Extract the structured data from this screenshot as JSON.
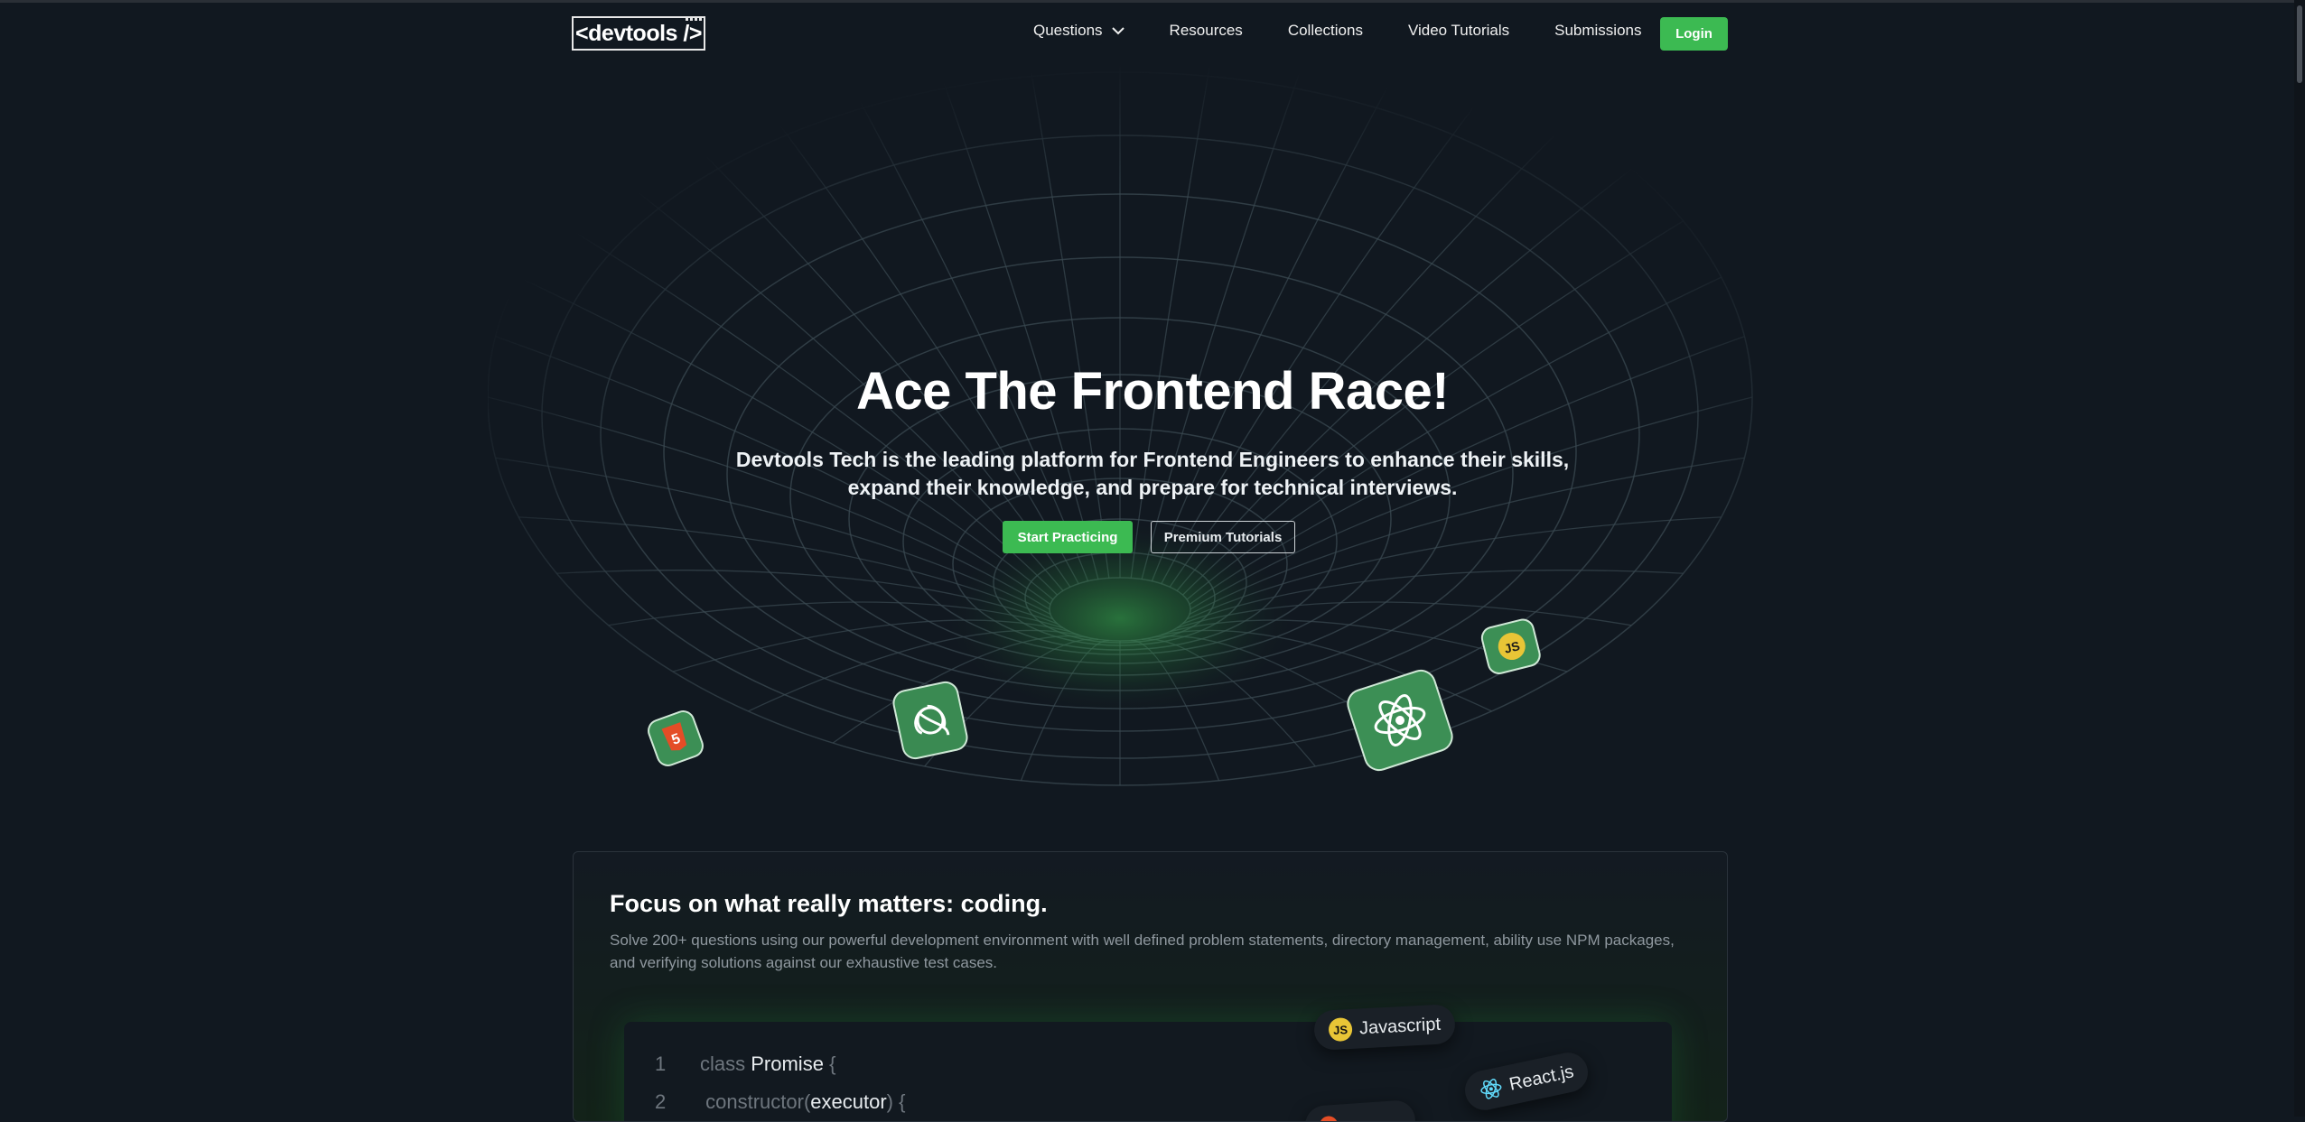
{
  "nav": {
    "logo_text": "<devtools />",
    "links": [
      "Questions",
      "Resources",
      "Collections",
      "Video Tutorials",
      "Submissions"
    ],
    "login_label": "Login"
  },
  "hero": {
    "title": "Ace The Frontend Race!",
    "subtitle": "Devtools Tech is the leading platform for Frontend Engineers to enhance their skills, expand their knowledge, and prepare for technical interviews.",
    "primary_cta": "Start Practicing",
    "secondary_cta": "Premium Tutorials",
    "tiles": [
      "html5-icon",
      "redux-icon",
      "react-icon",
      "javascript-icon"
    ]
  },
  "feature": {
    "title": "Focus on what really matters: coding.",
    "description": "Solve 200+ questions using our powerful development environment with well defined problem statements, directory management, ability use NPM packages, and verifying solutions against our exhaustive test cases.",
    "code": {
      "line1_num": "1",
      "line1_kw": "class",
      "line1_id": "Promise",
      "line1_brace": "{",
      "line2_num": "2",
      "line2_kw": "constructor",
      "line2_paren_open": "(",
      "line2_arg": "executor",
      "line2_paren_close": ")",
      "line2_brace": "{"
    },
    "chips": [
      "Javascript",
      "React.js"
    ]
  },
  "colors": {
    "accent": "#3cba52",
    "background": "#111820"
  }
}
